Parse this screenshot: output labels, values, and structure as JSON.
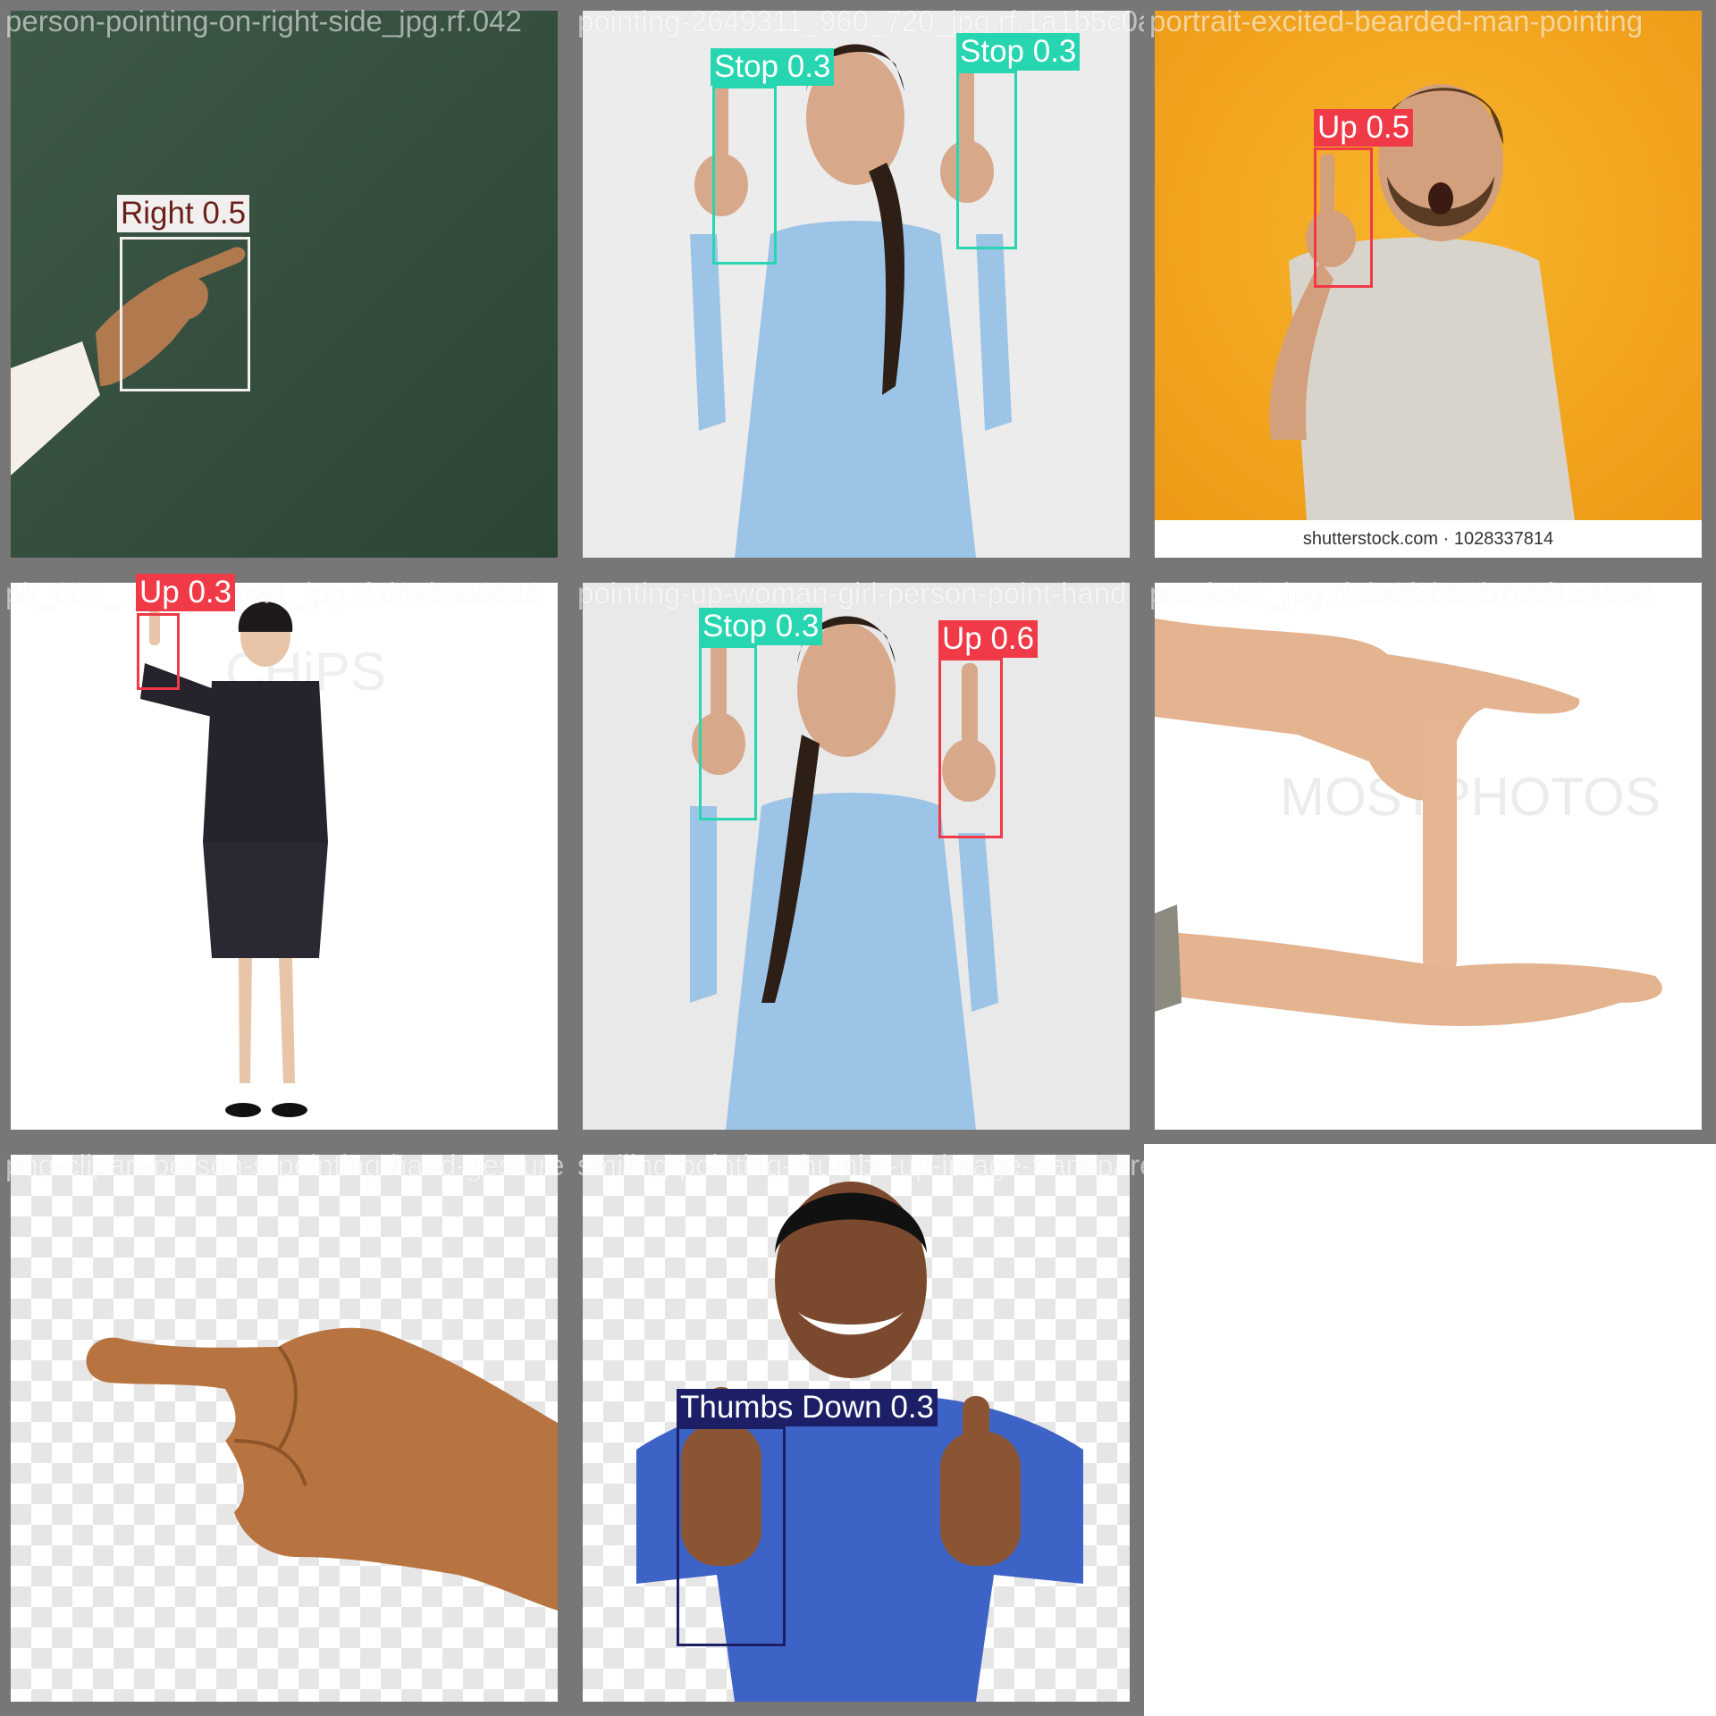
{
  "colors": {
    "stop": "#27d6b0",
    "up": "#f03a47",
    "right": "#f2f0ee",
    "thumbs_down": "#1c1f66",
    "thumbs_down_bar": "#e44bc8"
  },
  "tiles": [
    {
      "filename": "person-pointing-on-right-side_jpg.rf.042",
      "detections": [
        {
          "label": "Right 0.5"
        }
      ]
    },
    {
      "filename": "pointing-2649311_960_720_jpg.rf.1a1b5c0a",
      "detections": [
        {
          "label": "Stop 0.3"
        },
        {
          "label": "Stop 0.3"
        }
      ]
    },
    {
      "filename": "portrait-excited-bearded-man-pointing",
      "watermark": "shutterstock.com · 1028337814",
      "detections": [
        {
          "label": "Up 0.5"
        }
      ]
    },
    {
      "filename": "ph_007_... _031_pw1_jpg.rf.d8eb3a0618",
      "watermark": "CHiPS",
      "detections": [
        {
          "label": "Up 0.3"
        }
      ]
    },
    {
      "filename": "pointing-up-woman-girl-person-point-hand",
      "detections": [
        {
          "label": "Stop 0.3"
        },
        {
          "label": "Up 0.6"
        }
      ]
    },
    {
      "filename": "preview2_jpg.rf.de0f3b59b7c6f1a46e8",
      "watermark": "MOSTPHOTOS",
      "detections": []
    },
    {
      "filename": "png-clipart-person-s-pointing-hand-gesture",
      "detections": []
    },
    {
      "filename": "smiling-pointing-thumbs-up-image-transparent",
      "detections": [
        {
          "label": "Thumbs Down 0.3"
        }
      ]
    }
  ]
}
